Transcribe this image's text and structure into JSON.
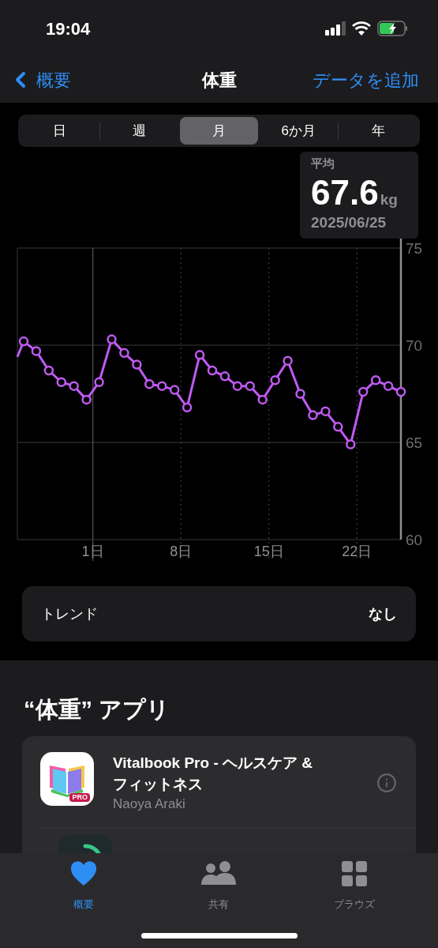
{
  "status_bar": {
    "time": "19:04"
  },
  "nav": {
    "back": "概要",
    "title": "体重",
    "action": "データを追加"
  },
  "segments": [
    {
      "label": "日",
      "selected": false
    },
    {
      "label": "週",
      "selected": false
    },
    {
      "label": "月",
      "selected": true
    },
    {
      "label": "6か月",
      "selected": false
    },
    {
      "label": "年",
      "selected": false
    }
  ],
  "summary": {
    "label": "平均",
    "value": "67.6",
    "unit": "kg",
    "date": "2025/06/25"
  },
  "chart_data": {
    "type": "line",
    "x": [
      -5,
      -4.5,
      -3.5,
      -2.5,
      -1.5,
      -0.5,
      0.5,
      1.5,
      2.5,
      3.5,
      4.5,
      5.5,
      6.5,
      7.5,
      8.5,
      9.5,
      10.5,
      11.5,
      12.5,
      13.5,
      14.5,
      15.5,
      16.5,
      17.5,
      18.5,
      19.5,
      20.5,
      21.5,
      22.5,
      23.5,
      24.5,
      25.5
    ],
    "grid": true,
    "ref_lines": [
      {
        "axis": "x",
        "value": 1,
        "color": "#48484a"
      }
    ],
    "series": [
      {
        "color": "#bf5af2",
        "marker": "circle",
        "values": [
          69.4,
          70.2,
          69.7,
          68.7,
          68.1,
          67.9,
          67.2,
          68.1,
          70.3,
          69.6,
          69.0,
          68.0,
          67.9,
          67.7,
          66.8,
          69.5,
          68.7,
          68.4,
          67.9,
          67.9,
          67.2,
          68.2,
          69.2,
          67.5,
          66.4,
          66.6,
          65.8,
          64.9,
          67.6,
          68.2,
          67.9,
          67.6
        ]
      }
    ],
    "xlim": [
      -5,
      25.5
    ],
    "ylim": [
      60,
      75
    ],
    "xticks": [
      {
        "value": 1,
        "label": "1日"
      },
      {
        "value": 8,
        "label": "8日"
      },
      {
        "value": 15,
        "label": "15日"
      },
      {
        "value": 22,
        "label": "22日"
      }
    ],
    "yticks": [
      60,
      65,
      70,
      75
    ]
  },
  "trend": {
    "label": "トレンド",
    "value": "なし"
  },
  "apps_section": {
    "title": "“体重” アプリ",
    "apps": [
      {
        "name": "Vitalbook Pro - ヘルスケア & フィットネス",
        "developer": "Naoya Araki",
        "badge": "PRO",
        "kind": "book"
      },
      {
        "kind": "ring"
      }
    ]
  },
  "tab_bar": [
    {
      "label": "概要",
      "selected": true,
      "kind": "heart"
    },
    {
      "label": "共有",
      "selected": false,
      "kind": "people"
    },
    {
      "label": "ブラウズ",
      "selected": false,
      "kind": "grid"
    }
  ]
}
